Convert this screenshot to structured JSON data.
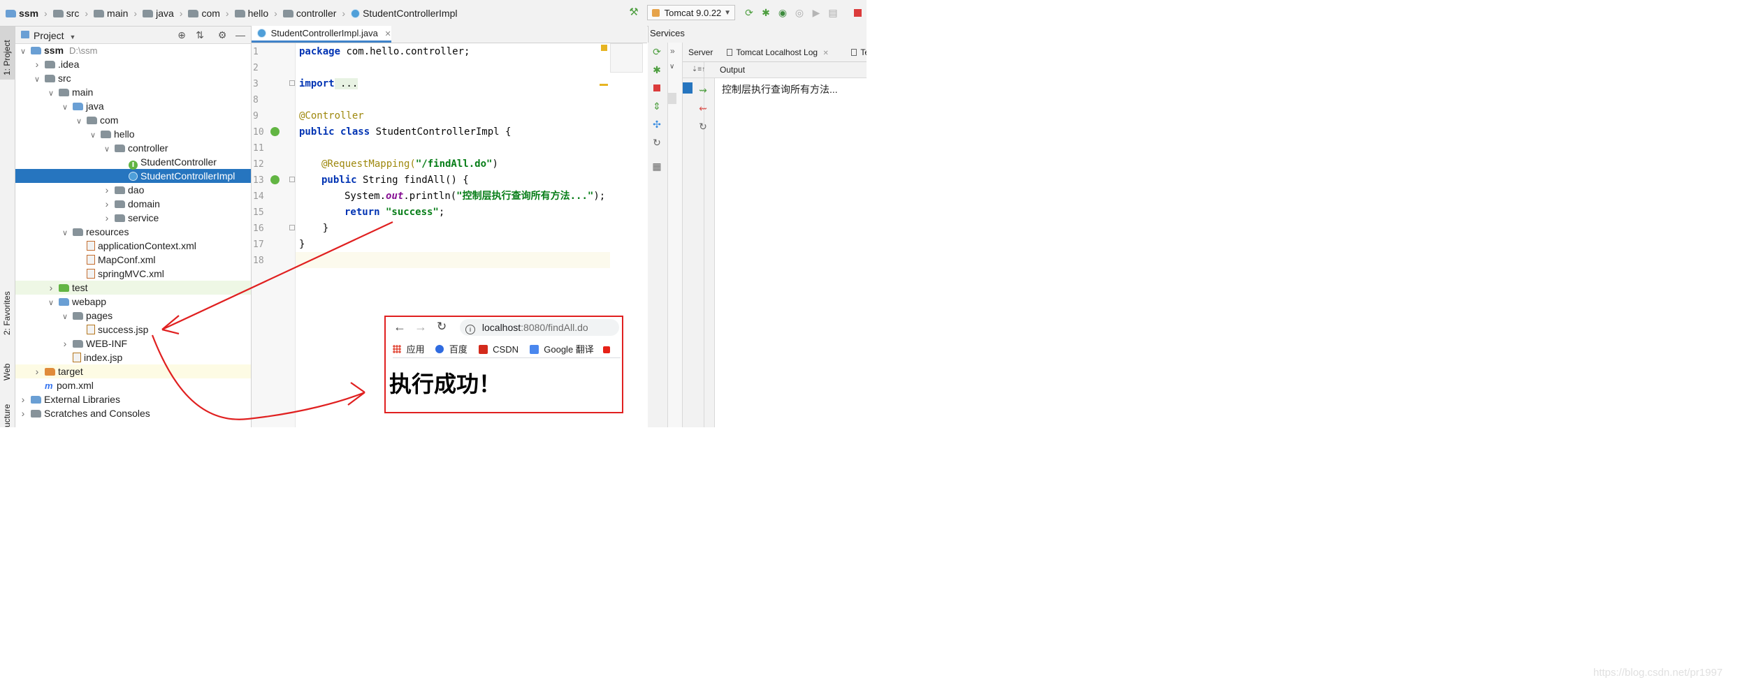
{
  "breadcrumb": [
    "ssm",
    "src",
    "main",
    "java",
    "com",
    "hello",
    "controller",
    "StudentControllerImpl"
  ],
  "run_config": "Tomcat 9.0.22",
  "left_strip": {
    "project": "1: Project",
    "favorites": "2: Favorites",
    "web": "Web",
    "structure": "ucture"
  },
  "project_panel": {
    "title": "Project",
    "tree": [
      {
        "label": "ssm",
        "hint": "D:\\ssm",
        "depth": 0,
        "chevron": "down",
        "icon": "folder-module"
      },
      {
        "label": ".idea",
        "depth": 1,
        "chevron": "right",
        "icon": "folder"
      },
      {
        "label": "src",
        "depth": 1,
        "chevron": "down",
        "icon": "folder"
      },
      {
        "label": "main",
        "depth": 2,
        "chevron": "down",
        "icon": "folder"
      },
      {
        "label": "java",
        "depth": 3,
        "chevron": "down",
        "icon": "folder-source"
      },
      {
        "label": "com",
        "depth": 4,
        "chevron": "down",
        "icon": "folder"
      },
      {
        "label": "hello",
        "depth": 5,
        "chevron": "down",
        "icon": "folder"
      },
      {
        "label": "controller",
        "depth": 6,
        "chevron": "down",
        "icon": "folder"
      },
      {
        "label": "StudentController",
        "depth": 7,
        "chevron": "none",
        "icon": "interface"
      },
      {
        "label": "StudentControllerImpl",
        "depth": 7,
        "chevron": "none",
        "icon": "class",
        "selected": true
      },
      {
        "label": "dao",
        "depth": 6,
        "chevron": "right",
        "icon": "folder"
      },
      {
        "label": "domain",
        "depth": 6,
        "chevron": "right",
        "icon": "folder"
      },
      {
        "label": "service",
        "depth": 6,
        "chevron": "right",
        "icon": "folder"
      },
      {
        "label": "resources",
        "depth": 3,
        "chevron": "down",
        "icon": "folder-resources"
      },
      {
        "label": "applicationContext.xml",
        "depth": 4,
        "chevron": "none",
        "icon": "xml"
      },
      {
        "label": "MapConf.xml",
        "depth": 4,
        "chevron": "none",
        "icon": "xml"
      },
      {
        "label": "springMVC.xml",
        "depth": 4,
        "chevron": "none",
        "icon": "xml"
      },
      {
        "label": "test",
        "depth": 2,
        "chevron": "right",
        "icon": "folder-test",
        "highlight": "green"
      },
      {
        "label": "webapp",
        "depth": 2,
        "chevron": "down",
        "icon": "folder-web"
      },
      {
        "label": "pages",
        "depth": 3,
        "chevron": "down",
        "icon": "folder"
      },
      {
        "label": "success.jsp",
        "depth": 4,
        "chevron": "none",
        "icon": "jsp"
      },
      {
        "label": "WEB-INF",
        "depth": 3,
        "chevron": "right",
        "icon": "folder"
      },
      {
        "label": "index.jsp",
        "depth": 3,
        "chevron": "none",
        "icon": "jsp"
      },
      {
        "label": "target",
        "depth": 1,
        "chevron": "right",
        "icon": "folder-excluded",
        "highlight": "yellow"
      },
      {
        "label": "pom.xml",
        "depth": 1,
        "chevron": "none",
        "icon": "maven"
      },
      {
        "label": "External Libraries",
        "depth": 0,
        "chevron": "right",
        "icon": "library"
      },
      {
        "label": "Scratches and Consoles",
        "depth": 0,
        "chevron": "right",
        "icon": "scratches"
      }
    ]
  },
  "editor": {
    "tab": "StudentControllerImpl.java",
    "line_numbers": [
      "1",
      "2",
      "3",
      "8",
      "9",
      "10",
      "11",
      "12",
      "13",
      "14",
      "15",
      "16",
      "17",
      "18"
    ],
    "code": {
      "l1_kw": "package",
      "l1_rest": " com.hello.controller;",
      "l3_kw": "import",
      "l3_rest": " ...",
      "l9_ann": "@Controller",
      "l10_kw": "public class",
      "l10_rest": " StudentControllerImpl {",
      "l12_ann": "@RequestMapping(",
      "l12_str": "\"/findAll.do\"",
      "l12_end": ")",
      "l13_kw": "public",
      "l13_rest": " String findAll() {",
      "l14_a": "System.",
      "l14_fld": "out",
      "l14_b": ".println(",
      "l14_str": "\"控制层执行查询所有方法...\"",
      "l14_end": ");",
      "l15_kw": "return",
      "l15_str": " \"success\"",
      "l15_end": ";",
      "l16": "    }",
      "l17": "}"
    }
  },
  "services": {
    "title": "Services",
    "tabs": [
      "Server",
      "Tomcat Localhost Log",
      "Te"
    ],
    "output_label": "Output",
    "output_text": "控制层执行查询所有方法..."
  },
  "browser": {
    "url_host": "localhost",
    "url_path": ":8080/findAll.do",
    "bookmarks": [
      "应用",
      "百度",
      "CSDN",
      "Google 翻译"
    ],
    "content": "执行成功！"
  },
  "watermark": "https://blog.csdn.net/pr1997",
  "colors": {
    "selection": "#2675bf",
    "annotation_red": "#e02020",
    "test_bg": "#eef7e5",
    "target_bg": "#fdfbe4"
  }
}
